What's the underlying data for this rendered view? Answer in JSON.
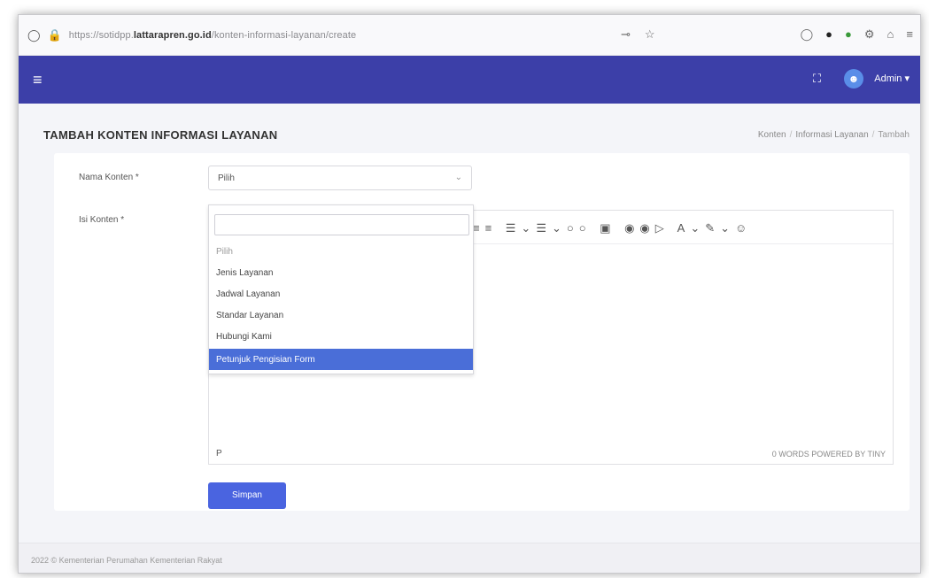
{
  "browser": {
    "url_prefix": "https://sotidpp.",
    "url_domain": "lattarapren.go.id",
    "url_path": "/konten-informasi-layanan/create"
  },
  "header": {
    "admin_label": "Admin"
  },
  "page": {
    "title": "TAMBAH KONTEN INFORMASI LAYANAN",
    "breadcrumb": [
      "Konten",
      "Informasi Layanan",
      "Tambah"
    ]
  },
  "form": {
    "nama_konten_label": "Nama Konten *",
    "nama_konten_value": "Pilih",
    "isi_konten_label": "Isi Konten *",
    "dropdown_search_value": "",
    "options": [
      "Pilih",
      "Jenis Layanan",
      "Jadwal Layanan",
      "Standar Layanan",
      "Hubungi Kami",
      "Petunjuk Pengisian Form"
    ],
    "selected_option_index": 5,
    "editor_status_left": "P",
    "editor_status_right": "0 WORDS  POWERED BY TINY",
    "save_label": "Simpan"
  },
  "footer": {
    "text": "2022 © Kementerian Perumahan Kementerian Rakyat"
  },
  "icons": {
    "menu": "hamburger-icon",
    "fullscreen": "fullscreen-icon",
    "avatar": "user-avatar-icon"
  },
  "colors": {
    "navbar": "#3c3fa8",
    "primary_button": "#4a64e0",
    "selected_option": "#4a6ed8"
  }
}
